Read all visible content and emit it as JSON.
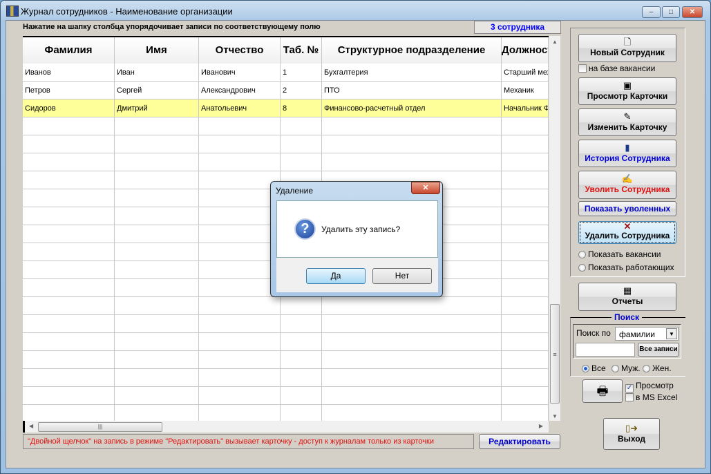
{
  "window": {
    "title": "Журнал сотрудников -  Наименование организации",
    "minimize": "–",
    "maximize": "□",
    "close": "✕"
  },
  "hint": "Нажатие на шапку столбца упорядочивает записи  по соответствующему полю",
  "count": "3 сотрудника",
  "table": {
    "columns": [
      "Фамилия",
      "Имя",
      "Отчество",
      "Таб. №",
      "Структурное подразделение",
      "Должност"
    ],
    "rows": [
      [
        "Иванов",
        "Иван",
        "Иванович",
        "1",
        "Бухгалтерия",
        "Старший механик"
      ],
      [
        "Петров",
        "Сергей",
        "Александрович",
        "2",
        "ПТО",
        "Механик"
      ],
      [
        "Сидоров",
        "Дмитрий",
        "Анатольевич",
        "8",
        "Финансово-расчетный отдел",
        "Начальник ФРО"
      ]
    ],
    "selected_row": 2
  },
  "footer": {
    "note": "\"Двойной щелчок\" на запись в режиме \"Редактировать\" вызывает карточку  -  доступ к журналам только из карточки",
    "edit": "Редактировать"
  },
  "side": {
    "new": "Новый Сотрудник",
    "vacancy_base": "на базе вакансии",
    "view": "Просмотр Карточки",
    "edit": "Изменить Карточку",
    "history": "История Сотрудника",
    "dismiss": "Уволить Сотрудника",
    "show_dismissed": "Показать уволенных",
    "delete": "Удалить Сотрудника",
    "show_vacancies": "Показать вакансии",
    "show_working": "Показать работающих",
    "reports": "Отчеты",
    "search_title": "Поиск",
    "search_by": "Поиск по",
    "search_field": "фамилии",
    "search_value": "",
    "all_records": "Все записи",
    "all": "Все",
    "male": "Муж.",
    "female": "Жен.",
    "preview": "Просмотр",
    "excel": "в MS Excel",
    "exit": "Выход"
  },
  "dialog": {
    "title": "Удаление",
    "message": "Удалить эту запись?",
    "yes": "Да",
    "no": "Нет",
    "close": "✕"
  },
  "colors": {
    "selected_row": "#ffff99",
    "accent_blue": "#0000ff",
    "alert_red": "#e01010"
  }
}
